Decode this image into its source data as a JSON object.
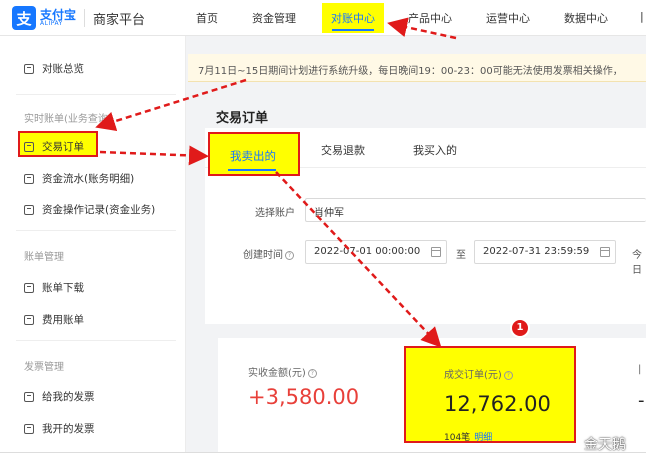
{
  "brand": {
    "logo_glyph": "支",
    "name_cn": "支付宝",
    "name_en": "ALIPAY",
    "title": "商家平台"
  },
  "nav": {
    "items": [
      "首页",
      "资金管理",
      "对账中心",
      "产品中心",
      "运营中心",
      "数据中心"
    ],
    "active_index": 2
  },
  "sidebar": {
    "overview": "对账总览",
    "group_realtime": "实时账单(业务查询)",
    "realtime_items": [
      "交易订单",
      "资金流水(账务明细)",
      "资金操作记录(资金业务)"
    ],
    "group_bill": "账单管理",
    "bill_items": [
      "账单下载",
      "费用账单"
    ],
    "group_invoice": "发票管理",
    "invoice_items": [
      "给我的发票",
      "我开的发票"
    ]
  },
  "notice": {
    "text": "7月11日~15日期间计划进行系统升级，每日晚间19：00-23：00可能无法使用发票相关操作，"
  },
  "page": {
    "title": "交易订单"
  },
  "tabs": [
    "我卖出的",
    "交易退款",
    "我买入的"
  ],
  "filters": {
    "account_label": "选择账户",
    "account_value": "肖仲军",
    "created_label": "创建时间",
    "date_start": "2022-07-01 00:00:00",
    "range_sep": "至",
    "date_end": "2022-07-31 23:59:59",
    "quick": "今日"
  },
  "stats": {
    "received_label": "实收金额(元)",
    "received_value": "+3,580.00",
    "orders_label": "成交订单(元)",
    "orders_value": "12,762.00",
    "orders_count": "104笔",
    "orders_link": "明细"
  },
  "annotation": {
    "badge": "1",
    "watermark": "金天鹅"
  },
  "colors": {
    "highlight": "#ffff00",
    "annotation_red": "#e01a1a",
    "brand_blue": "#1677ff",
    "amount_red": "#e8403a"
  }
}
